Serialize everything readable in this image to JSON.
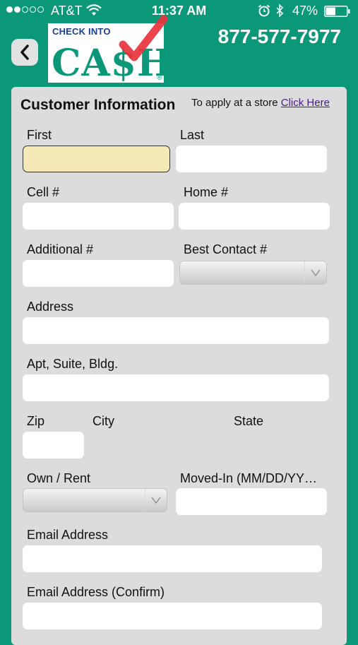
{
  "status": {
    "carrier": "AT&T",
    "time": "11:37 AM",
    "battery_percent": "47%",
    "battery_level": 0.47,
    "signal_full": 2,
    "signal_total": 5
  },
  "header": {
    "logo_top": "CHECK INTO",
    "logo_main": "CA$H",
    "logo_reg": "®",
    "phone": "877-577-7977"
  },
  "form": {
    "title": "Customer Information",
    "apply_prefix": "To apply at a store",
    "apply_link": "Click Here",
    "first_label": "First",
    "last_label": "Last",
    "cell_label": "Cell #",
    "home_label": "Home #",
    "additional_label": "Additional #",
    "best_contact_label": "Best Contact #",
    "address_label": "Address",
    "apt_label": "Apt, Suite, Bldg.",
    "zip_label": "Zip",
    "city_label": "City",
    "state_label": "State",
    "own_rent_label": "Own / Rent",
    "moved_in_label": "Moved-In (MM/DD/YY…",
    "email_label": "Email Address",
    "email_confirm_label": "Email Address (Confirm)"
  },
  "colors": {
    "background": "#0a9879",
    "panel": "#dcdcdc",
    "focused_field": "#f5e9b5",
    "link": "#4a1a8a"
  },
  "icons": [
    "signal-dots",
    "wifi-icon",
    "alarm-icon",
    "bluetooth-icon",
    "battery-icon",
    "back-arrow-icon",
    "checkmark-icon",
    "dropdown-arrow-icon"
  ]
}
